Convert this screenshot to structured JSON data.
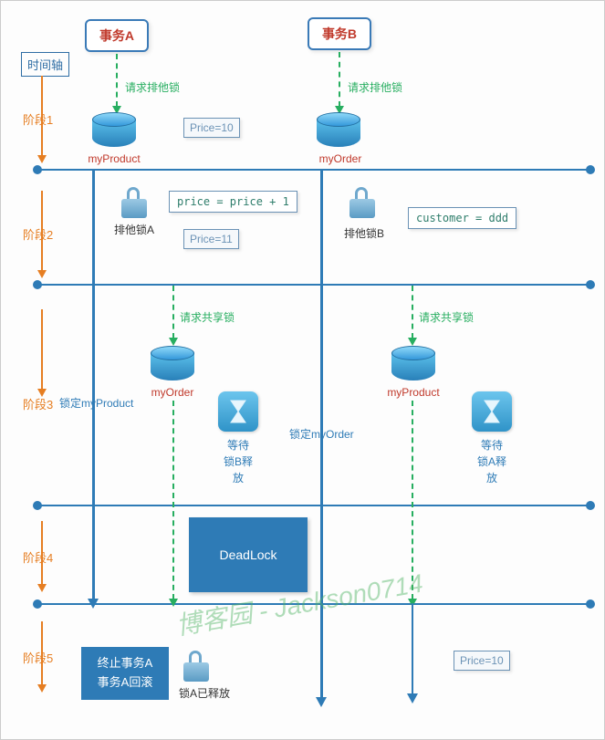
{
  "transactions": {
    "a": "事务A",
    "b": "事务B"
  },
  "timeAxis": "时间轴",
  "phases": [
    "阶段1",
    "阶段2",
    "阶段3",
    "阶段4",
    "阶段5"
  ],
  "requestExclusive": "请求排他锁",
  "requestShared": "请求共享锁",
  "dbLabels": {
    "myProduct": "myProduct",
    "myOrder": "myOrder"
  },
  "prices": {
    "p10": "Price=10",
    "p11": "Price=11"
  },
  "code": {
    "incPrice": "price = price + 1",
    "customer": "customer = ddd"
  },
  "locks": {
    "exA": "排他锁A",
    "exB": "排他锁B",
    "releasedA": "锁A已释放"
  },
  "locked": {
    "product": "锁定myProduct",
    "order": "锁定myOrder"
  },
  "wait": {
    "label": "等待",
    "lockB": "锁B释",
    "lockA": "锁A释",
    "release": "放"
  },
  "deadlock": "DeadLock",
  "terminate": {
    "line1": "终止事务A",
    "line2": "事务A回滚"
  },
  "watermark": "博客园 - Jackson0714"
}
